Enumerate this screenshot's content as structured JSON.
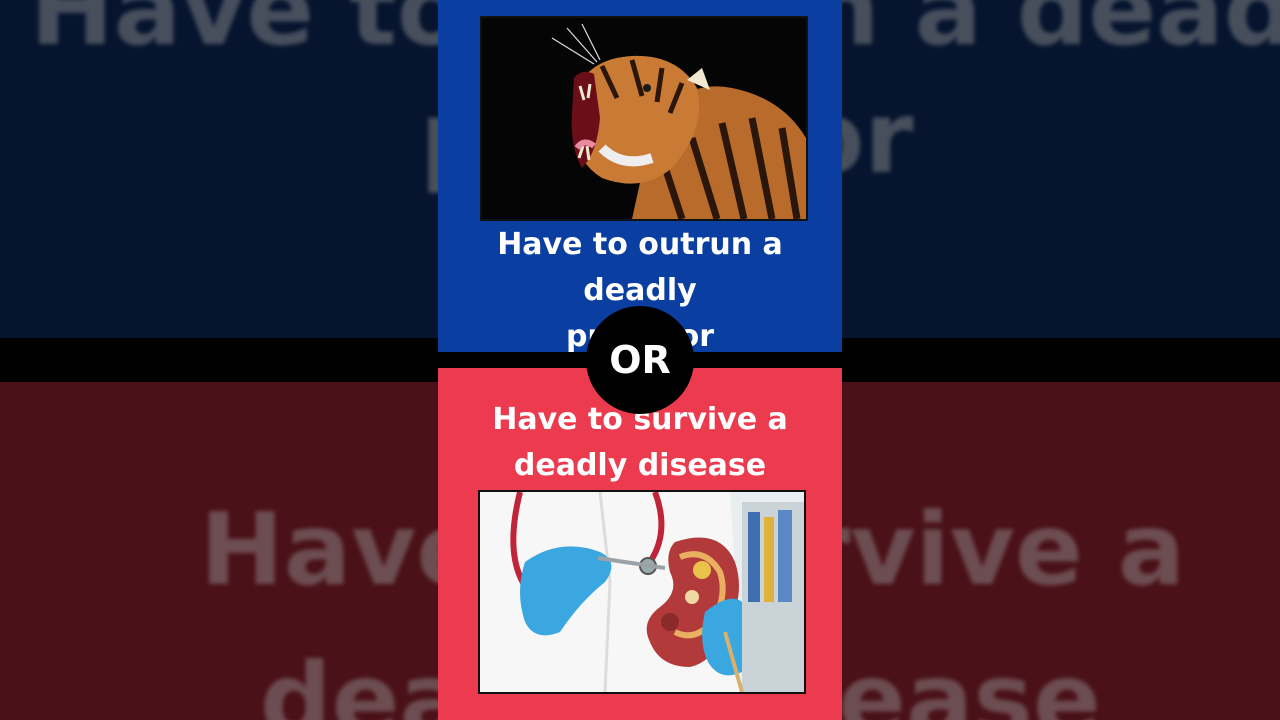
{
  "background": {
    "top_color": "#06142e",
    "bottom_color": "#4a1118",
    "ghost_text_1": "Have to outrun a deadly",
    "ghost_text_2": "predator",
    "ghost_text_3": "Have to survive a",
    "ghost_text_4": "deadly disease"
  },
  "panel": {
    "top_color": "#0a3ea0",
    "bottom_color": "#ec3b4e",
    "option_a": {
      "image_icon": "tiger-roaring-image",
      "line1": "Have to outrun a deadly",
      "line2": "predator"
    },
    "separator": {
      "label": "OR"
    },
    "option_b": {
      "image_icon": "doctor-kidney-model-image",
      "line1": "Have to survive a",
      "line2": "deadly disease"
    }
  }
}
